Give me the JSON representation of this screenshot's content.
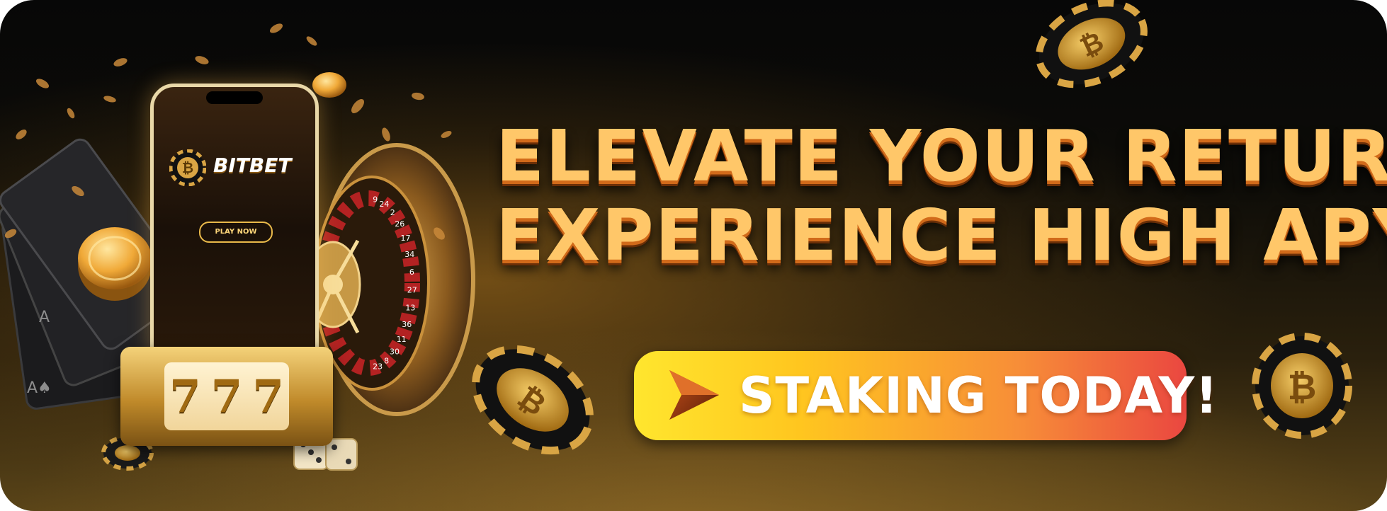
{
  "headline": {
    "line1": "ELEVATE YOUR RETURNS:",
    "line2": "EXPERIENCE HIGH APY"
  },
  "cta": {
    "label": "STAKING TODAY!",
    "arrow_icon": "play-arrow-icon"
  },
  "phone": {
    "brand": "BITBET",
    "play_button": "PLAY NOW"
  },
  "slot": {
    "reels": [
      "7",
      "7",
      "7"
    ]
  },
  "roulette_numbers": [
    "9",
    "24",
    "2",
    "26",
    "17",
    "34",
    "6",
    "27",
    "13",
    "36",
    "11",
    "30",
    "8",
    "23"
  ],
  "colors": {
    "headline": "#ffc769",
    "headline_shadow": "#d16a1a",
    "cta_start": "#ffe62e",
    "cta_end": "#ea4740",
    "background": "#0d0c08",
    "gold": "#c08a2a"
  }
}
